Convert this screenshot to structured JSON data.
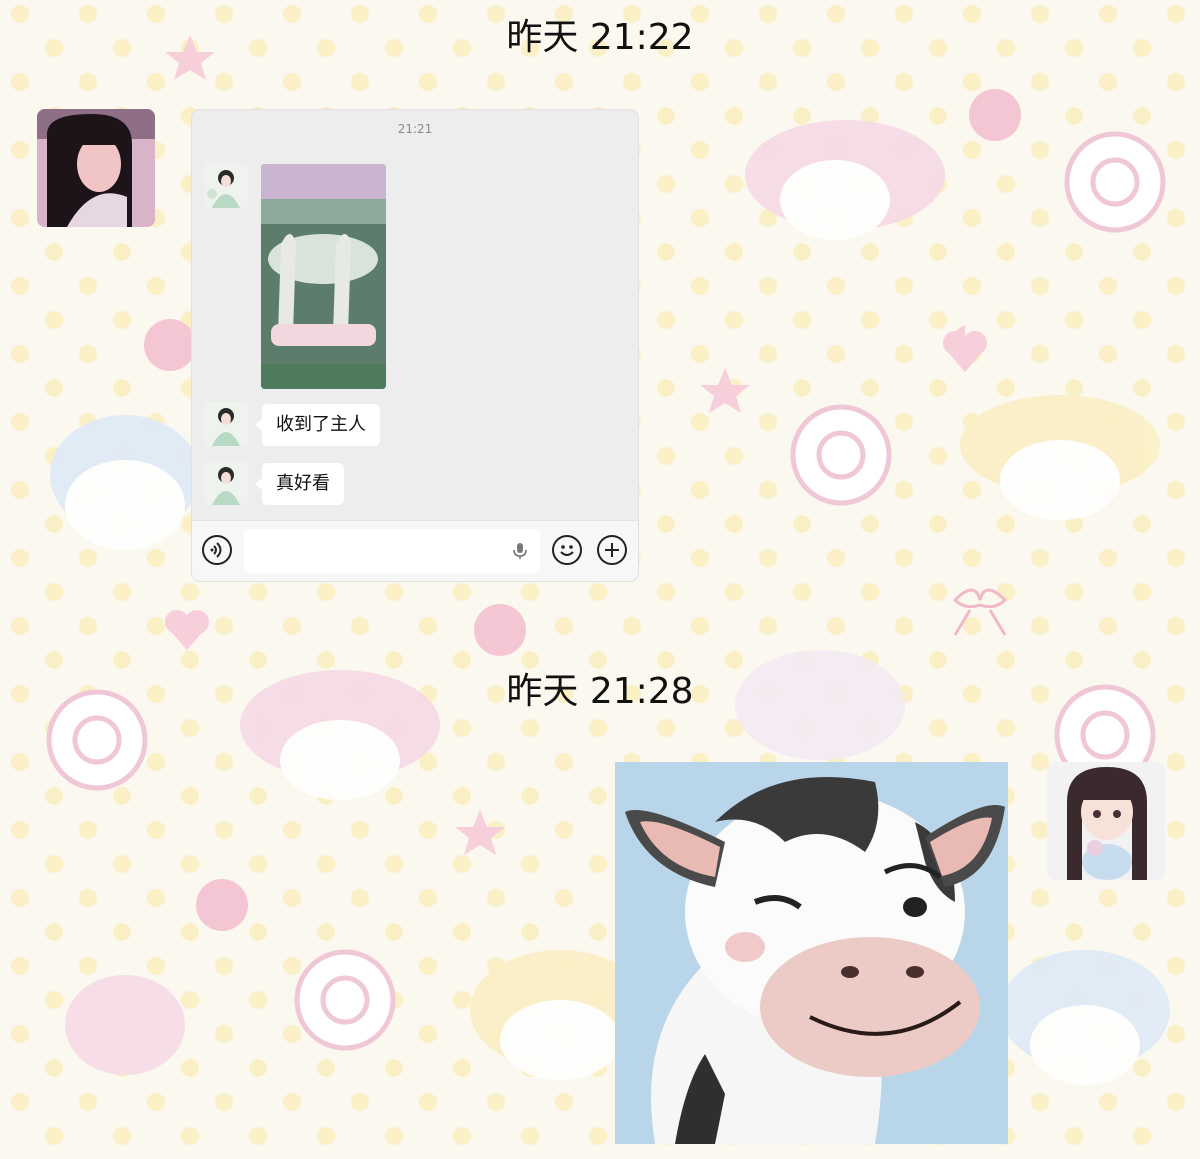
{
  "timestamps": [
    "昨天 21:22",
    "昨天 21:28"
  ],
  "screenshot": {
    "time": "21:21",
    "messages": [
      "收到了主人",
      "真好看"
    ]
  },
  "icons": {
    "voice": "voice-icon",
    "microphone": "microphone-icon",
    "emoji": "emoji-icon",
    "plus": "plus-icon"
  },
  "colors": {
    "background": "#fbf8ef",
    "chat_bg": "#ededed",
    "bubble": "#ffffff"
  }
}
